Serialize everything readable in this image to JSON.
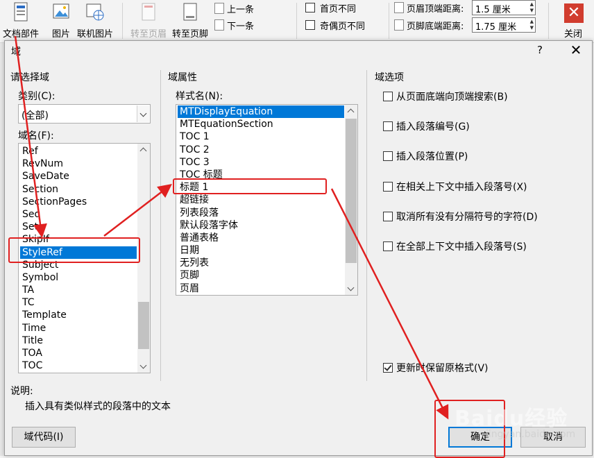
{
  "ribbon": {
    "doc_parts": "文档部件",
    "picture": "图片",
    "online_picture": "联机图片",
    "go_to_header": "转至页眉",
    "go_to_footer": "转至页脚",
    "previous": "上一条",
    "next": "下一条",
    "different_first_page": "首页不同",
    "different_odd_even": "奇偶页不同",
    "header_from_top": "页眉顶端距离:",
    "header_from_top_value": "1.5 厘米",
    "footer_from_bottom": "页脚底端距离:",
    "footer_from_bottom_value": "1.75 厘米",
    "close": "关闭"
  },
  "dialog": {
    "title": "域",
    "help": "?",
    "close": "✕",
    "choose_field": "请选择域",
    "category_label": "类别(C):",
    "category_value": "(全部)",
    "field_names_label": "域名(F):",
    "field_names": [
      "Ref",
      "RevNum",
      "SaveDate",
      "Section",
      "SectionPages",
      "Seq",
      "Set",
      "SkipIf",
      "StyleRef",
      "Subject",
      "Symbol",
      "TA",
      "TC",
      "Template",
      "Time",
      "Title",
      "TOA",
      "TOC"
    ],
    "field_properties": "域属性",
    "style_name_label": "样式名(N):",
    "style_names": [
      "MTDisplayEquation",
      "MTEquationSection",
      "TOC 1",
      "TOC 2",
      "TOC 3",
      "TOC 标题",
      "标题 1",
      "超链接",
      "列表段落",
      "默认段落字体",
      "普通表格",
      "日期",
      "无列表",
      "页脚",
      "页眉"
    ],
    "field_options": "域选项",
    "options": [
      {
        "label": "从页面底端向顶端搜索(B)",
        "checked": false
      },
      {
        "label": "插入段落编号(G)",
        "checked": false
      },
      {
        "label": "插入段落位置(P)",
        "checked": false
      },
      {
        "label": "在相关上下文中插入段落号(X)",
        "checked": false
      },
      {
        "label": "取消所有没有分隔符号的字符(D)",
        "checked": false
      },
      {
        "label": "在全部上下文中插入段落号(S)",
        "checked": false
      }
    ],
    "preserve_format": "更新时保留原格式(V)",
    "description_label": "说明:",
    "description_text": "插入具有类似样式的段落中的文本",
    "field_codes_button": "域代码(I)",
    "ok_button": "确定",
    "cancel_button": "取消"
  },
  "watermark": {
    "text": "Baidu经验",
    "url_text": "jingyan.baidu.com"
  },
  "colors": {
    "accent": "#0078d7",
    "annotation": "#e02020",
    "close_red": "#d13c2e"
  }
}
